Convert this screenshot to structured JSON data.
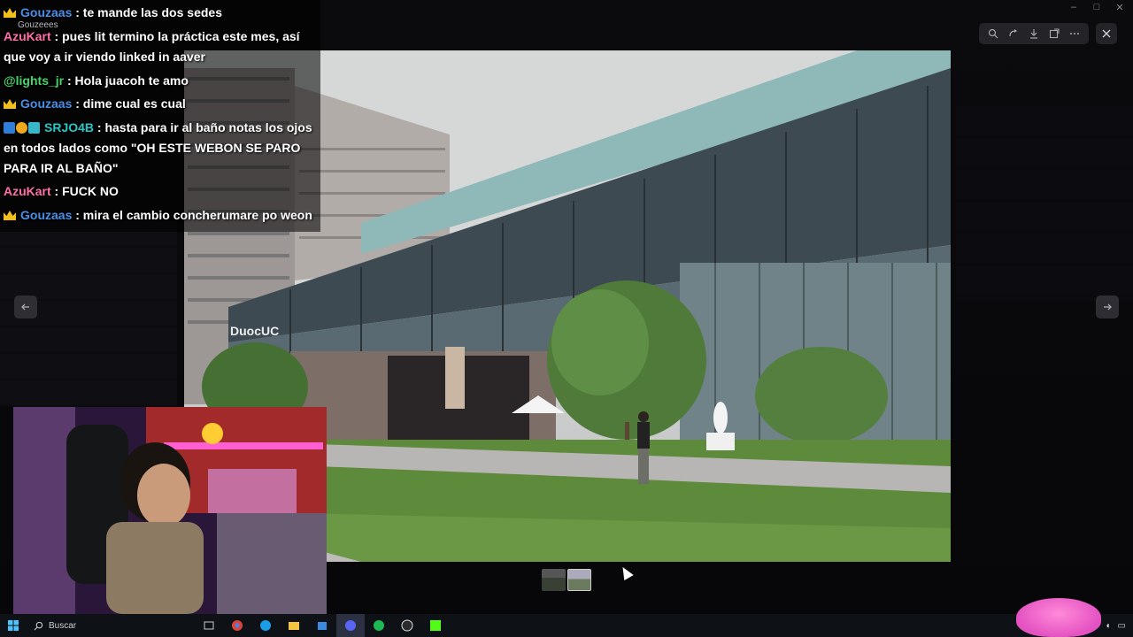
{
  "viewer": {
    "toolbar_icons": [
      "zoom-icon",
      "rotate-icon",
      "download-icon",
      "open-external-icon",
      "more-icon"
    ],
    "close_icon": "close-icon"
  },
  "window": {
    "minimize": "–",
    "maximize": "□",
    "close": "✕"
  },
  "chat": {
    "reply_hint": "Gouzeees",
    "messages": [
      {
        "user": "Gouzaas",
        "user_color": "#4a8fe7",
        "badges": [
          "crown"
        ],
        "text": " : te mande las dos sedes"
      },
      {
        "user": "AzuKart",
        "user_color": "#ff6fa8",
        "badges": [],
        "text": " : pues lit termino la práctica este mes, así que voy a ir viendo linked in aaver"
      },
      {
        "user": "@lights_jr",
        "user_color": "#46d46a",
        "badges": [],
        "text": " : Hola juacoh te amo"
      },
      {
        "user": "Gouzaas",
        "user_color": "#4a8fe7",
        "badges": [
          "crown"
        ],
        "text": " : dime cual es cual"
      },
      {
        "user": "SRJO4B",
        "user_color": "#29c7c7",
        "badges": [
          "prime",
          "gold",
          "sub"
        ],
        "text": " : hasta para ir al baño notas los ojos en todos lados como \"OH ESTE WEBON SE PARO PARA IR AL BAÑO\""
      },
      {
        "user": "AzuKart",
        "user_color": "#ff6fa8",
        "badges": [],
        "text": " : FUCK NO"
      },
      {
        "user": "Gouzaas",
        "user_color": "#4a8fe7",
        "badges": [
          "crown"
        ],
        "text": " : mira el cambio concherumare po weon"
      }
    ]
  },
  "photo": {
    "sign_text": "DuocUC"
  },
  "taskbar": {
    "search_placeholder": "Buscar",
    "apps": [
      "task-view-icon",
      "chrome-icon",
      "edge-icon",
      "file-explorer-icon",
      "store-icon",
      "discord-icon",
      "spotify-icon",
      "obs-icon",
      "kick-icon"
    ],
    "active_app": "discord-icon"
  }
}
